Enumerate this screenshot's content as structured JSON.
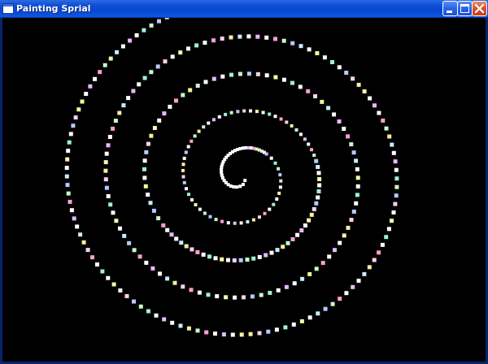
{
  "window": {
    "title": "Painting Sprial"
  },
  "icons": {
    "app": "window-app-icon",
    "minimize": "minimize-icon",
    "maximize": "maximize-icon",
    "close": "close-icon"
  },
  "colors": {
    "titlebar": "#0a47cf",
    "canvas_background": "#000000",
    "dots": [
      "#ffffff",
      "#ffffff",
      "#ffffff",
      "#ffffff",
      "#c8f8c8",
      "#ffd0f0",
      "#c8ecff",
      "#fff6a8",
      "#e8b8ff",
      "#9ff0d8",
      "#ff9ed0",
      "#b8c8ff",
      "#f0f0a0"
    ]
  }
}
